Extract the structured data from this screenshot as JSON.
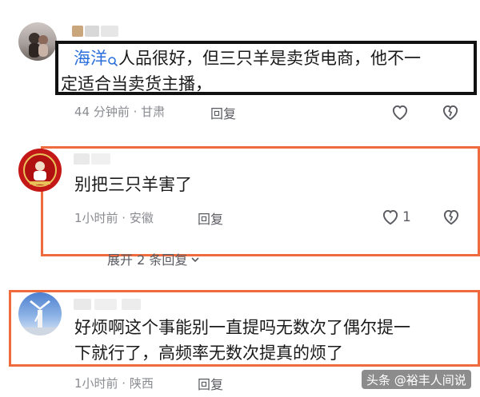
{
  "comments": [
    {
      "username": "海洋",
      "text_line1": "人品很好，但三只羊是卖货电商，他不一",
      "text_line2": "定适合当卖货主播，",
      "time": "44 分钟前 · 甘肃",
      "reply_label": "回复"
    },
    {
      "text": "别把三只羊害了",
      "time": "1小时前 · 安徽",
      "reply_label": "回复",
      "like_count": "1"
    },
    {
      "text_line1": "好烦啊这个事能别一直提吗无数次了偶尔提一",
      "text_line2": "下就行了，高频率无数次提真的烦了",
      "time": "1小时前 · 陕西",
      "reply_label": "回复"
    }
  ],
  "expand_replies": "展开 2 条回复",
  "watermark": "头条 @裕丰人间说",
  "colors": {
    "highlight_orange": "#ef6a3d",
    "highlight_black": "#111111"
  }
}
